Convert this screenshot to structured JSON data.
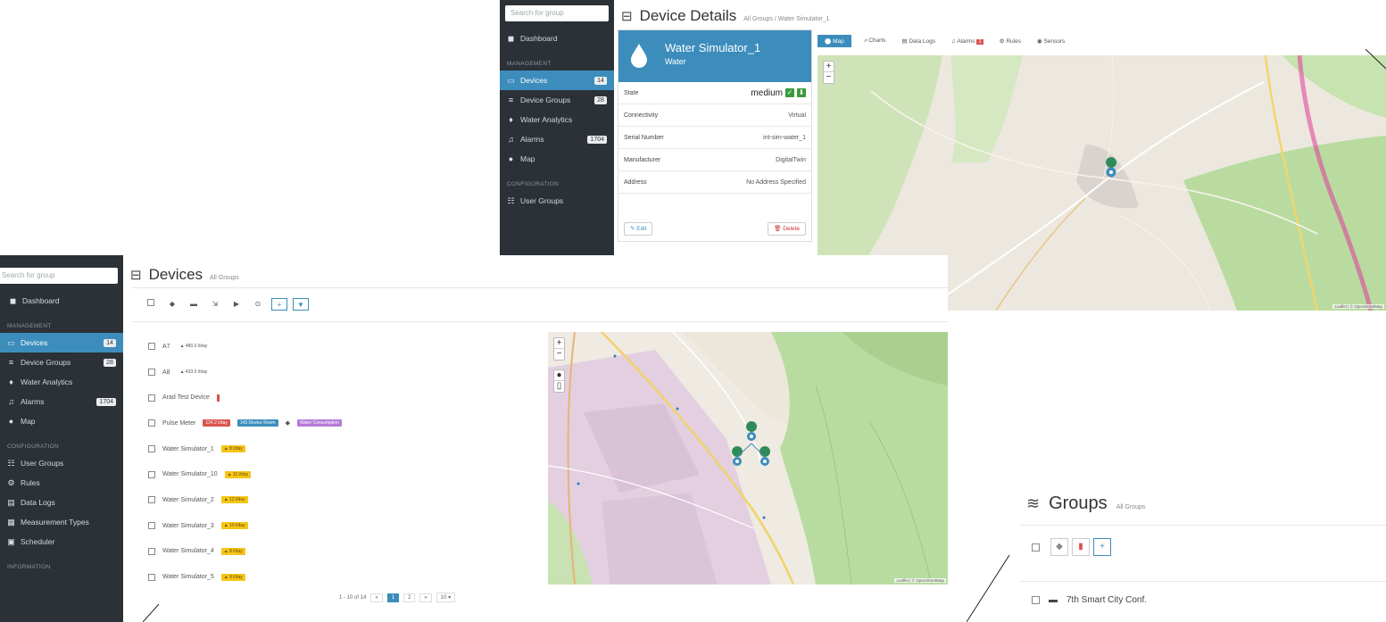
{
  "details": {
    "sidebar": {
      "search_placeholder": "Search for group",
      "items": [
        {
          "label": "Dashboard",
          "badge": ""
        },
        {
          "label": "Devices",
          "badge": "14"
        },
        {
          "label": "Device Groups",
          "badge": "28"
        },
        {
          "label": "Water Analytics",
          "badge": ""
        },
        {
          "label": "Alarms",
          "badge": "1704"
        },
        {
          "label": "Map",
          "badge": ""
        },
        {
          "label": "User Groups",
          "badge": ""
        }
      ],
      "section_management": "MANAGEMENT",
      "section_configuration": "CONFIGURATION"
    },
    "title": "Device Details",
    "breadcrumb": "All Groups / Water Simulator_1",
    "device": {
      "name": "Water Simulator_1",
      "type": "Water",
      "rows": [
        {
          "label": "State",
          "value": "medium"
        },
        {
          "label": "Connectivity",
          "value": "Virtual"
        },
        {
          "label": "Serial Number",
          "value": "int-sim-water_1"
        },
        {
          "label": "Manufacturer",
          "value": "DigitalTwin"
        },
        {
          "label": "Address",
          "value": "No Address Specified"
        }
      ],
      "edit_label": "Edit",
      "delete_label": "Delete"
    },
    "tabs": [
      {
        "label": "Map"
      },
      {
        "label": "Charts"
      },
      {
        "label": "Data Logs"
      },
      {
        "label": "Alarms",
        "badge": "1"
      },
      {
        "label": "Rules"
      },
      {
        "label": "Sensors"
      }
    ],
    "map_attribution": "Leaflet | © OpenStreetMap"
  },
  "devices": {
    "sidebar": {
      "search_placeholder": "Search for group",
      "items": [
        {
          "label": "Dashboard",
          "badge": ""
        },
        {
          "label": "Devices",
          "badge": "14"
        },
        {
          "label": "Device Groups",
          "badge": "28"
        },
        {
          "label": "Water Analytics",
          "badge": ""
        },
        {
          "label": "Alarms",
          "badge": "1704"
        },
        {
          "label": "Map",
          "badge": ""
        },
        {
          "label": "User Groups",
          "badge": ""
        },
        {
          "label": "Rules",
          "badge": ""
        },
        {
          "label": "Data Logs",
          "badge": ""
        },
        {
          "label": "Measurement Types",
          "badge": ""
        },
        {
          "label": "Scheduler",
          "badge": ""
        }
      ],
      "section_management": "MANAGEMENT",
      "section_configuration": "CONFIGURATION",
      "section_information": "INFORMATION"
    },
    "title": "Devices",
    "breadcrumb": "All Groups",
    "rows": [
      {
        "name": "A7",
        "tags": [
          {
            "kind": "plain",
            "text": "480.0 l/day"
          }
        ]
      },
      {
        "name": "A8",
        "tags": [
          {
            "kind": "plain",
            "text": "433.0 l/day"
          }
        ]
      },
      {
        "name": "Arad Test Device",
        "tags": [
          {
            "kind": "bar",
            "text": ""
          }
        ]
      },
      {
        "name": "Pulse Meter",
        "tags": [
          {
            "kind": "r",
            "text": "124.2 l/day"
          },
          {
            "kind": "b",
            "text": "143 Device Room"
          },
          {
            "kind": "p",
            "text": "Water Consumption"
          }
        ]
      },
      {
        "name": "Water Simulator_1",
        "tags": [
          {
            "kind": "y",
            "text": "8 l/day"
          }
        ]
      },
      {
        "name": "Water Simulator_10",
        "tags": [
          {
            "kind": "y",
            "text": "11 l/day"
          }
        ]
      },
      {
        "name": "Water Simulator_2",
        "tags": [
          {
            "kind": "y",
            "text": "12 l/day"
          }
        ]
      },
      {
        "name": "Water Simulator_3",
        "tags": [
          {
            "kind": "y",
            "text": "10 l/day"
          }
        ]
      },
      {
        "name": "Water Simulator_4",
        "tags": [
          {
            "kind": "y",
            "text": "8 l/day"
          }
        ]
      },
      {
        "name": "Water Simulator_5",
        "tags": [
          {
            "kind": "y",
            "text": "9 l/day"
          }
        ]
      }
    ],
    "pager": {
      "summary": "1 - 10 of 14",
      "prev": "«",
      "pages": [
        "1",
        "2"
      ],
      "next": "»",
      "per_page": "10 ▾"
    },
    "map_attribution": "Leaflet | © OpenStreetMap"
  },
  "groups": {
    "title": "Groups",
    "breadcrumb": "All Groups",
    "rows": [
      {
        "name": "7th Smart City Conf."
      }
    ]
  }
}
